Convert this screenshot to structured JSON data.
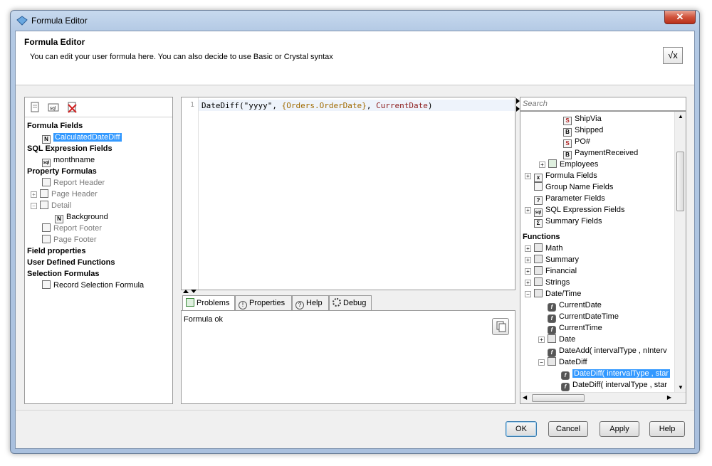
{
  "window": {
    "title": "Formula Editor",
    "close_glyph": "✕"
  },
  "header": {
    "title": "Formula Editor",
    "subtitle": "You can edit your user formula here. You can also decide to use Basic or Crystal syntax",
    "syntax_button": "√x"
  },
  "left_tree": [
    {
      "label": "Formula Fields",
      "style": "bold"
    },
    {
      "label": "CalculatedDateDiff",
      "icon": "N",
      "selected": true
    },
    {
      "label": "SQL Expression Fields",
      "style": "bold"
    },
    {
      "label": "monthname",
      "icon": "sql"
    },
    {
      "label": "Property Formulas",
      "style": "bold"
    },
    {
      "label": "Report Header",
      "grey": true
    },
    {
      "label": "Page Header",
      "grey": true
    },
    {
      "label": "Detail",
      "grey": true
    },
    {
      "label": "Background",
      "icon": "N"
    },
    {
      "label": "Report Footer",
      "grey": true
    },
    {
      "label": "Page Footer",
      "grey": true
    },
    {
      "label": "Field properties",
      "style": "bold"
    },
    {
      "label": "User Defined Functions",
      "style": "bold"
    },
    {
      "label": "Selection Formulas",
      "style": "bold"
    },
    {
      "label": "Record Selection Formula"
    }
  ],
  "editor": {
    "line_number": "1",
    "code_fn": "DateDiff",
    "code_arg1": "(\"yyyy\", ",
    "code_field": "{Orders.OrderDate}",
    "code_sep": ", ",
    "code_kw": "CurrentDate",
    "code_end": ")"
  },
  "tabs": [
    "Problems",
    "Properties",
    "Help",
    "Debug"
  ],
  "problems": {
    "message": "Formula ok"
  },
  "search": {
    "placeholder": "Search"
  },
  "right_tree_top": [
    {
      "label": "ShipVia",
      "icon": "S"
    },
    {
      "label": "Shipped",
      "icon": "B"
    },
    {
      "label": "PO#",
      "icon": "S"
    },
    {
      "label": "PaymentReceived",
      "icon": "B"
    },
    {
      "label": "Employees"
    },
    {
      "label": "Formula Fields"
    },
    {
      "label": "Group Name Fields"
    },
    {
      "label": "Parameter Fields"
    },
    {
      "label": "SQL Expression Fields"
    },
    {
      "label": "Summary Fields"
    }
  ],
  "functions_header": "Functions",
  "right_tree_fn": [
    {
      "label": "Math"
    },
    {
      "label": "Summary"
    },
    {
      "label": "Financial"
    },
    {
      "label": "Strings"
    },
    {
      "label": "Date/Time"
    },
    {
      "label": "CurrentDate",
      "icon": "f"
    },
    {
      "label": "CurrentDateTime",
      "icon": "f"
    },
    {
      "label": "CurrentTime",
      "icon": "f"
    },
    {
      "label": "Date"
    },
    {
      "label": "DateAdd( intervalType , nInterv",
      "icon": "f"
    },
    {
      "label": "DateDiff"
    },
    {
      "label": "DateDiff( intervalType , star",
      "icon": "f",
      "selected": true
    },
    {
      "label": "DateDiff( intervalType , star",
      "icon": "f"
    }
  ],
  "buttons": {
    "ok": "OK",
    "cancel": "Cancel",
    "apply": "Apply",
    "help": "Help"
  },
  "colors": {
    "selection": "#3399ff",
    "code_field": "#a06a00",
    "code_kw": "#8b1a1a"
  }
}
